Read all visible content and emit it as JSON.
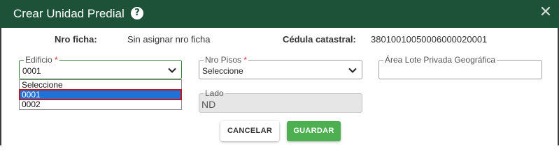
{
  "dialog": {
    "title": "Crear Unidad Predial",
    "help_icon": "question-circle-icon",
    "close_icon": "close-icon",
    "header_color": "#1e5238"
  },
  "info": {
    "nro_ficha_label": "Nro ficha:",
    "nro_ficha_value": "Sin asignar nro ficha",
    "cedula_label": "Cédula catastral:",
    "cedula_value": "3801001005000600002000​1"
  },
  "form": {
    "edificio": {
      "label": "Edificio",
      "required_mark": "*",
      "value": "0001",
      "options": [
        "Seleccione",
        "0001",
        "0002"
      ],
      "highlighted_option": "0001"
    },
    "nro_pisos": {
      "label": "Nro Pisos",
      "required_mark": "*",
      "value": "Seleccione"
    },
    "area_lote": {
      "label": "Área Lote Privada Geográfica",
      "value": ""
    },
    "lado": {
      "label": "Lado",
      "value": "ND"
    }
  },
  "actions": {
    "cancel_label": "CANCELAR",
    "save_label": "GUARDAR",
    "save_color": "#4caf50"
  }
}
